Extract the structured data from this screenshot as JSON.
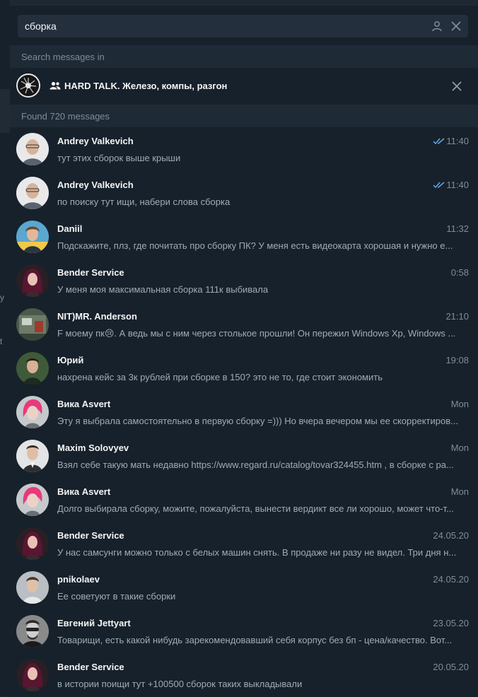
{
  "search": {
    "query": "сборка"
  },
  "search_in_header": "Search messages in",
  "chat_filter": {
    "title": "HARD TALK. Железо, компы, разгон"
  },
  "found_header": "Found 720 messages",
  "left_fragments": [
    "y",
    "t"
  ],
  "colors": {
    "panel_bg": "#17212b",
    "header_bg": "#1e2a36",
    "accent_ticks": "#5fa8e8",
    "text_primary": "#f5f5f5",
    "text_secondary": "#9eacb9"
  },
  "results": [
    {
      "name": "Andrey Valkevich",
      "time": "11:40",
      "read": true,
      "text": "тут этих сборок выше крыши",
      "avatar": "a1"
    },
    {
      "name": "Andrey Valkevich",
      "time": "11:40",
      "read": true,
      "text": "по поиску тут ищи, набери слова сборка",
      "avatar": "a1"
    },
    {
      "name": "Daniil",
      "time": "11:32",
      "read": false,
      "text": "Подскажите, плз, где почитать про сборку ПК? У меня есть видеокарта хорошая и нужно е...",
      "avatar": "a2"
    },
    {
      "name": "Bender Service",
      "time": "0:58",
      "read": false,
      "text": "У меня моя максимальная сборка 111к выбивала",
      "avatar": "a3"
    },
    {
      "name": "NIT)MR. Anderson",
      "time": "21:10",
      "read": false,
      "text": "F моему пк😢. А ведь мы с ним через столькое прошли! Он пережил Windows Xp, Windows ...",
      "avatar": "a4"
    },
    {
      "name": "Юрий",
      "time": "19:08",
      "read": false,
      "text": "нахрена кейс за 3к рублей при сборке в 150? это не то, где стоит экономить",
      "avatar": "a5"
    },
    {
      "name": "Вика Asvert",
      "time": "Mon",
      "read": false,
      "text": "Эту я выбрала самостоятельно в первую сборку =))) Но вчера вечером мы ее скорректиров...",
      "avatar": "a6"
    },
    {
      "name": "Maxim Solovyev",
      "time": "Mon",
      "read": false,
      "text": "Взял себе такую мать недавно https://www.regard.ru/catalog/tovar324455.htm , в сборке с ра...",
      "avatar": "a7"
    },
    {
      "name": "Вика Asvert",
      "time": "Mon",
      "read": false,
      "text": "Долго выбирала сборку, можите, пожалуйста, вынести вердикт все ли хорошо, может что-т...",
      "avatar": "a6"
    },
    {
      "name": "Bender Service",
      "time": "24.05.20",
      "read": false,
      "text": "У нас самсунги можно только с белых машин снять. В продаже ни разу не видел. Три дня н...",
      "avatar": "a3"
    },
    {
      "name": "pnikolaev",
      "time": "24.05.20",
      "read": false,
      "text": "Ее советуют в такие сборки",
      "avatar": "a8"
    },
    {
      "name": "Евгений Jettyart",
      "time": "23.05.20",
      "read": false,
      "text": "Товарищи, есть какой нибудь зарекомендовавший себя корпус без бп - цена/качество. Вот...",
      "avatar": "a9"
    },
    {
      "name": "Bender Service",
      "time": "20.05.20",
      "read": false,
      "text": "в истории поищи тут +100500 сборок таких выкладывали",
      "avatar": "a3"
    }
  ]
}
